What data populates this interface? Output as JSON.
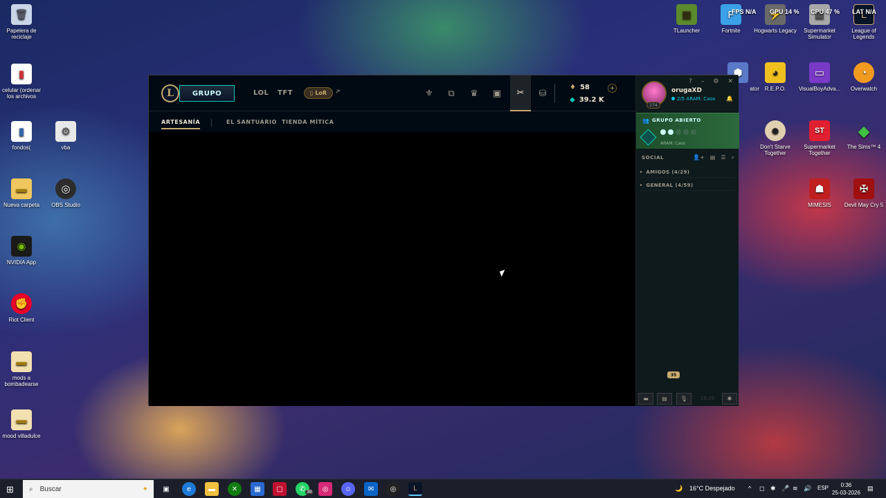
{
  "desktop": {
    "left_icons": [
      {
        "label": "Papelera de reciclaje",
        "icon": "recycle-bin-icon",
        "color": "#c9d6e8"
      },
      {
        "label": "celular (ordenar los archivos",
        "icon": "folder-icon",
        "color": "#ffffff"
      },
      {
        "label": "fondos(",
        "icon": "folder-icon",
        "color": "#ffffff"
      },
      {
        "label": "vba",
        "icon": "file-icon",
        "color": "#e8e8e8"
      },
      {
        "label": "Nueva carpeta",
        "icon": "folder-icon",
        "color": "#f0c75e"
      },
      {
        "label": "OBS Studio",
        "icon": "obs-icon",
        "color": "#2c2c2c"
      },
      {
        "label": "NVIDIA App",
        "icon": "nvidia-icon",
        "color": "#76b900"
      },
      {
        "label": "Riot Client",
        "icon": "riot-icon",
        "color": "#eb0029"
      },
      {
        "label": "mods a bombadearse",
        "icon": "folder-icon",
        "color": "#f3e0b0"
      },
      {
        "label": "mood villadulce",
        "icon": "folder-icon",
        "color": "#f3e0b0"
      }
    ],
    "right_icons": [
      {
        "label": "TLauncher",
        "icon": "tlauncher-icon",
        "color": "#5a8a2c"
      },
      {
        "label": "Fortnite",
        "icon": "fortnite-icon",
        "color": "#3aa0e8"
      },
      {
        "label": "Hogwarts Legacy",
        "icon": "hogwarts-icon",
        "color": "#6a6a6a"
      },
      {
        "label": "Supermarket Simulator",
        "icon": "supermarket-icon",
        "color": "#a8a8a8"
      },
      {
        "label": "League of Legends",
        "icon": "lol-icon",
        "color": "#0a1428"
      },
      {
        "label": "ator",
        "icon": "app-icon",
        "color": "#5a7ac8"
      },
      {
        "label": "R.E.P.O.",
        "icon": "repo-icon",
        "color": "#f0c020"
      },
      {
        "label": "VisualBoyAdva...",
        "icon": "vba-icon",
        "color": "#7a3ac8"
      },
      {
        "label": "Overwatch",
        "icon": "overwatch-icon",
        "color": "#f09a20"
      },
      {
        "label": "Don't Starve Together",
        "icon": "dst-icon",
        "color": "#e0d0b0"
      },
      {
        "label": "Supermarket Together",
        "icon": "st-icon",
        "color": "#e02030"
      },
      {
        "label": "The Sims™ 4",
        "icon": "sims-icon",
        "color": "#40c040"
      },
      {
        "label": "MIMESIS",
        "icon": "mimesis-icon",
        "color": "#c02020"
      },
      {
        "label": "Devil May Cry 5",
        "icon": "dmc-icon",
        "color": "#a01010"
      }
    ],
    "sysmon": {
      "fps": "FPS N/A",
      "gpu": "GPU 14 %",
      "cpu": "CPU 47 %",
      "lat": "LAT N/A"
    }
  },
  "client": {
    "play_label": "GRUPO",
    "nav_links": [
      "LOL",
      "TFT"
    ],
    "lor_label": "LoR",
    "nav_icons": [
      "tft-icon",
      "collection-icon",
      "ranked-icon",
      "loot-icon",
      "crafting-icon",
      "store-icon"
    ],
    "blue_essence": "58",
    "rp": "39.2 K",
    "sub_tabs": [
      "ARTESANÍA",
      "EL SANTUARIO",
      "TIENDA MÍTICA"
    ],
    "active_tab": 0
  },
  "social": {
    "username": "orugaXD",
    "status": "2/5 ARAM: Caos",
    "level": "274",
    "lobby_title": "GRUPO ABIERTO",
    "lobby_mode": "ARAM: Caos",
    "lobby_filled": 2,
    "lobby_size": 5,
    "header": "SOCIAL",
    "groups": [
      "AMIGOS (4/29)",
      "GENERAL (4/59)"
    ],
    "dock_badge": "35",
    "version": "26.05"
  },
  "taskbar": {
    "search_placeholder": "Buscar",
    "whatsapp_badge": "38",
    "weather": "16°C Despejado",
    "language": "ESP",
    "time": "0:36",
    "date": "25-03-2026"
  },
  "colors": {
    "gold": "#c8aa6e",
    "teal": "#0ac8b9",
    "lobby_green": "#2c6a3c"
  }
}
